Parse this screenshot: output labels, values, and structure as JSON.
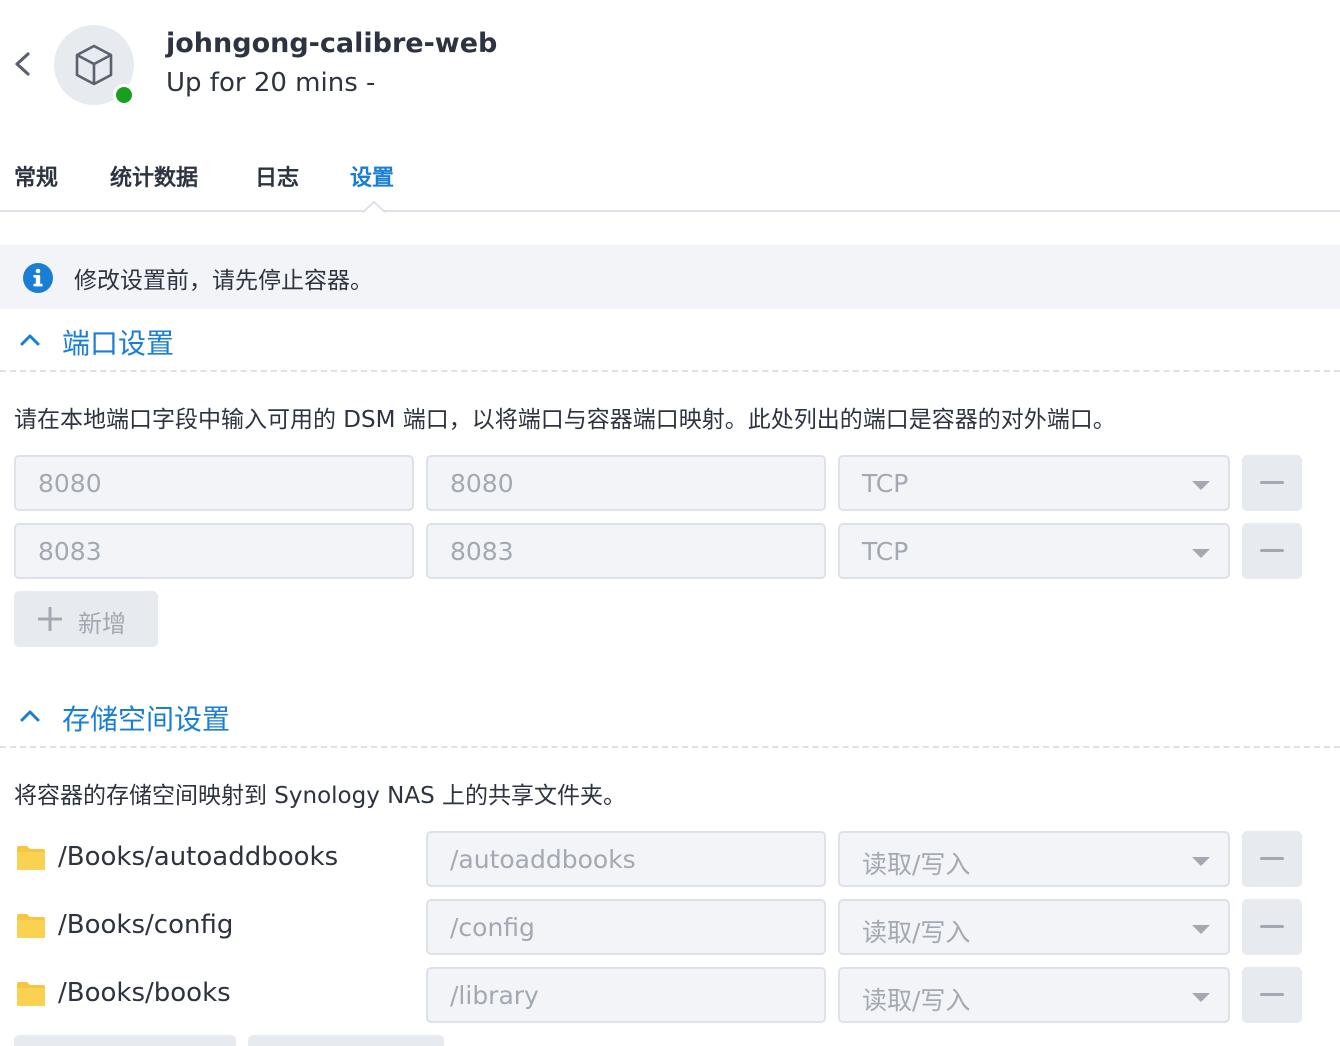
{
  "header": {
    "title": "johngong-calibre-web",
    "subtitle": "Up for 20 mins -"
  },
  "tabs": [
    {
      "label": "常规",
      "active": false
    },
    {
      "label": "统计数据",
      "active": false
    },
    {
      "label": "日志",
      "active": false
    },
    {
      "label": "设置",
      "active": true
    }
  ],
  "banner": {
    "text": "修改设置前，请先停止容器。"
  },
  "ports": {
    "title": "端口设置",
    "description": "请在本地端口字段中输入可用的 DSM 端口，以将端口与容器端口映射。此处列出的端口是容器的对外端口。",
    "rows": [
      {
        "local": "8080",
        "container": "8080",
        "protocol": "TCP"
      },
      {
        "local": "8083",
        "container": "8083",
        "protocol": "TCP"
      }
    ],
    "add_label": "新增"
  },
  "storage": {
    "title": "存储空间设置",
    "description": "将容器的存储空间映射到 Synology NAS 上的共享文件夹。",
    "rows": [
      {
        "folder": "/Books/autoaddbooks",
        "mount": "/autoaddbooks",
        "mode": "读取/写入"
      },
      {
        "folder": "/Books/config",
        "mount": "/config",
        "mode": "读取/写入"
      },
      {
        "folder": "/Books/books",
        "mount": "/library",
        "mode": "读取/写入"
      }
    ]
  },
  "colors": {
    "accent": "#1a7fd4",
    "status_running": "#16a01e",
    "folder": "#f6c544"
  }
}
